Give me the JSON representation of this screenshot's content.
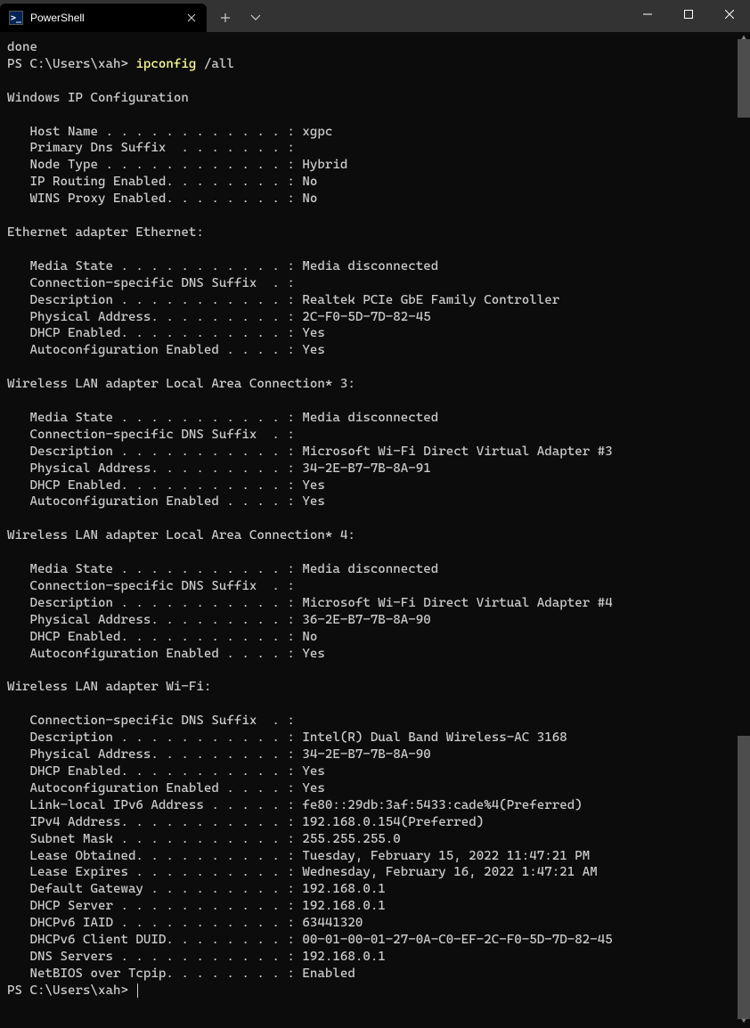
{
  "titlebar": {
    "tab_title": "PowerShell",
    "tab_icon_glyph": ">_"
  },
  "terminal": {
    "line_done": "done",
    "prompt1": "PS C:\\Users\\xah> ",
    "cmd": "ipconfig",
    "arg": " /all",
    "blank": "",
    "hdr_winip": "Windows IP Configuration",
    "winip": {
      "hostname": "   Host Name . . . . . . . . . . . . : xgpc",
      "dnssuffix": "   Primary Dns Suffix  . . . . . . . :",
      "nodetype": "   Node Type . . . . . . . . . . . . : Hybrid",
      "iprouting": "   IP Routing Enabled. . . . . . . . : No",
      "winsproxy": "   WINS Proxy Enabled. . . . . . . . : No"
    },
    "hdr_eth": "Ethernet adapter Ethernet:",
    "eth": {
      "media": "   Media State . . . . . . . . . . . : Media disconnected",
      "connsfx": "   Connection-specific DNS Suffix  . :",
      "desc": "   Description . . . . . . . . . . . : Realtek PCIe GbE Family Controller",
      "phys": "   Physical Address. . . . . . . . . : 2C-F0-5D-7D-82-45",
      "dhcp": "   DHCP Enabled. . . . . . . . . . . : Yes",
      "autocfg": "   Autoconfiguration Enabled . . . . : Yes"
    },
    "hdr_lan3": "Wireless LAN adapter Local Area Connection* 3:",
    "lan3": {
      "media": "   Media State . . . . . . . . . . . : Media disconnected",
      "connsfx": "   Connection-specific DNS Suffix  . :",
      "desc": "   Description . . . . . . . . . . . : Microsoft Wi-Fi Direct Virtual Adapter #3",
      "phys": "   Physical Address. . . . . . . . . : 34-2E-B7-7B-8A-91",
      "dhcp": "   DHCP Enabled. . . . . . . . . . . : Yes",
      "autocfg": "   Autoconfiguration Enabled . . . . : Yes"
    },
    "hdr_lan4": "Wireless LAN adapter Local Area Connection* 4:",
    "lan4": {
      "media": "   Media State . . . . . . . . . . . : Media disconnected",
      "connsfx": "   Connection-specific DNS Suffix  . :",
      "desc": "   Description . . . . . . . . . . . : Microsoft Wi-Fi Direct Virtual Adapter #4",
      "phys": "   Physical Address. . . . . . . . . : 36-2E-B7-7B-8A-90",
      "dhcp": "   DHCP Enabled. . . . . . . . . . . : No",
      "autocfg": "   Autoconfiguration Enabled . . . . : Yes"
    },
    "hdr_wifi": "Wireless LAN adapter Wi-Fi:",
    "wifi": {
      "connsfx": "   Connection-specific DNS Suffix  . :",
      "desc": "   Description . . . . . . . . . . . : Intel(R) Dual Band Wireless-AC 3168",
      "phys": "   Physical Address. . . . . . . . . : 34-2E-B7-7B-8A-90",
      "dhcp": "   DHCP Enabled. . . . . . . . . . . : Yes",
      "autocfg": "   Autoconfiguration Enabled . . . . : Yes",
      "llv6": "   Link-local IPv6 Address . . . . . : fe80::29db:3af:5433:cade%4(Preferred)",
      "ipv4": "   IPv4 Address. . . . . . . . . . . : 192.168.0.154(Preferred)",
      "mask": "   Subnet Mask . . . . . . . . . . . : 255.255.255.0",
      "leaseobt": "   Lease Obtained. . . . . . . . . . : Tuesday, February 15, 2022 11:47:21 PM",
      "leaseexp": "   Lease Expires . . . . . . . . . . : Wednesday, February 16, 2022 1:47:21 AM",
      "gateway": "   Default Gateway . . . . . . . . . : 192.168.0.1",
      "dhcpsrv": "   DHCP Server . . . . . . . . . . . : 192.168.0.1",
      "iaid": "   DHCPv6 IAID . . . . . . . . . . . : 63441320",
      "duid": "   DHCPv6 Client DUID. . . . . . . . : 00-01-00-01-27-0A-C0-EF-2C-F0-5D-7D-82-45",
      "dns": "   DNS Servers . . . . . . . . . . . : 192.168.0.1",
      "netbios": "   NetBIOS over Tcpip. . . . . . . . : Enabled"
    },
    "prompt2": "PS C:\\Users\\xah> "
  }
}
